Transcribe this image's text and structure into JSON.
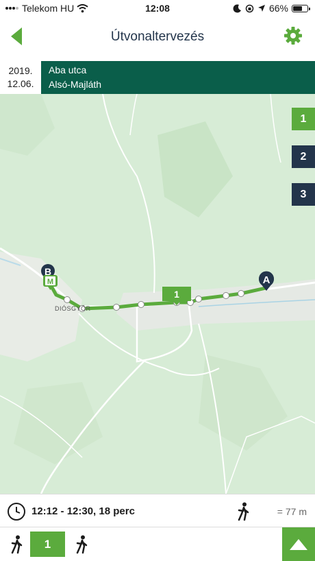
{
  "status_bar": {
    "carrier": "Telekom HU",
    "time": "12:08",
    "battery": "66%",
    "battery_level": 0.66
  },
  "header": {
    "title": "Útvonaltervezés"
  },
  "route": {
    "date_line1": "2019.",
    "date_line2": "12.06.",
    "from": "Aba utca",
    "to": "Alsó-Majláth"
  },
  "map": {
    "place_label": "DIÓSGYŐR",
    "route_label": "1",
    "start_marker": "A",
    "end_marker": "B",
    "metro_marker": "M",
    "colors": {
      "route": "#5bab3d",
      "marker": "#23354b"
    }
  },
  "itineraries": [
    {
      "label": "1",
      "active": true
    },
    {
      "label": "2",
      "active": false
    },
    {
      "label": "3",
      "active": false
    }
  ],
  "summary": {
    "time_range": "12:12 - 12:30,  18 perc",
    "walk_distance": "= 77 m"
  },
  "legs": {
    "bus_line": "1"
  },
  "icons": [
    "back-arrow-icon",
    "gear-icon",
    "clock-icon",
    "walk-icon",
    "triangle-up-icon",
    "wifi-icon",
    "moon-icon",
    "location-arrow-icon"
  ]
}
